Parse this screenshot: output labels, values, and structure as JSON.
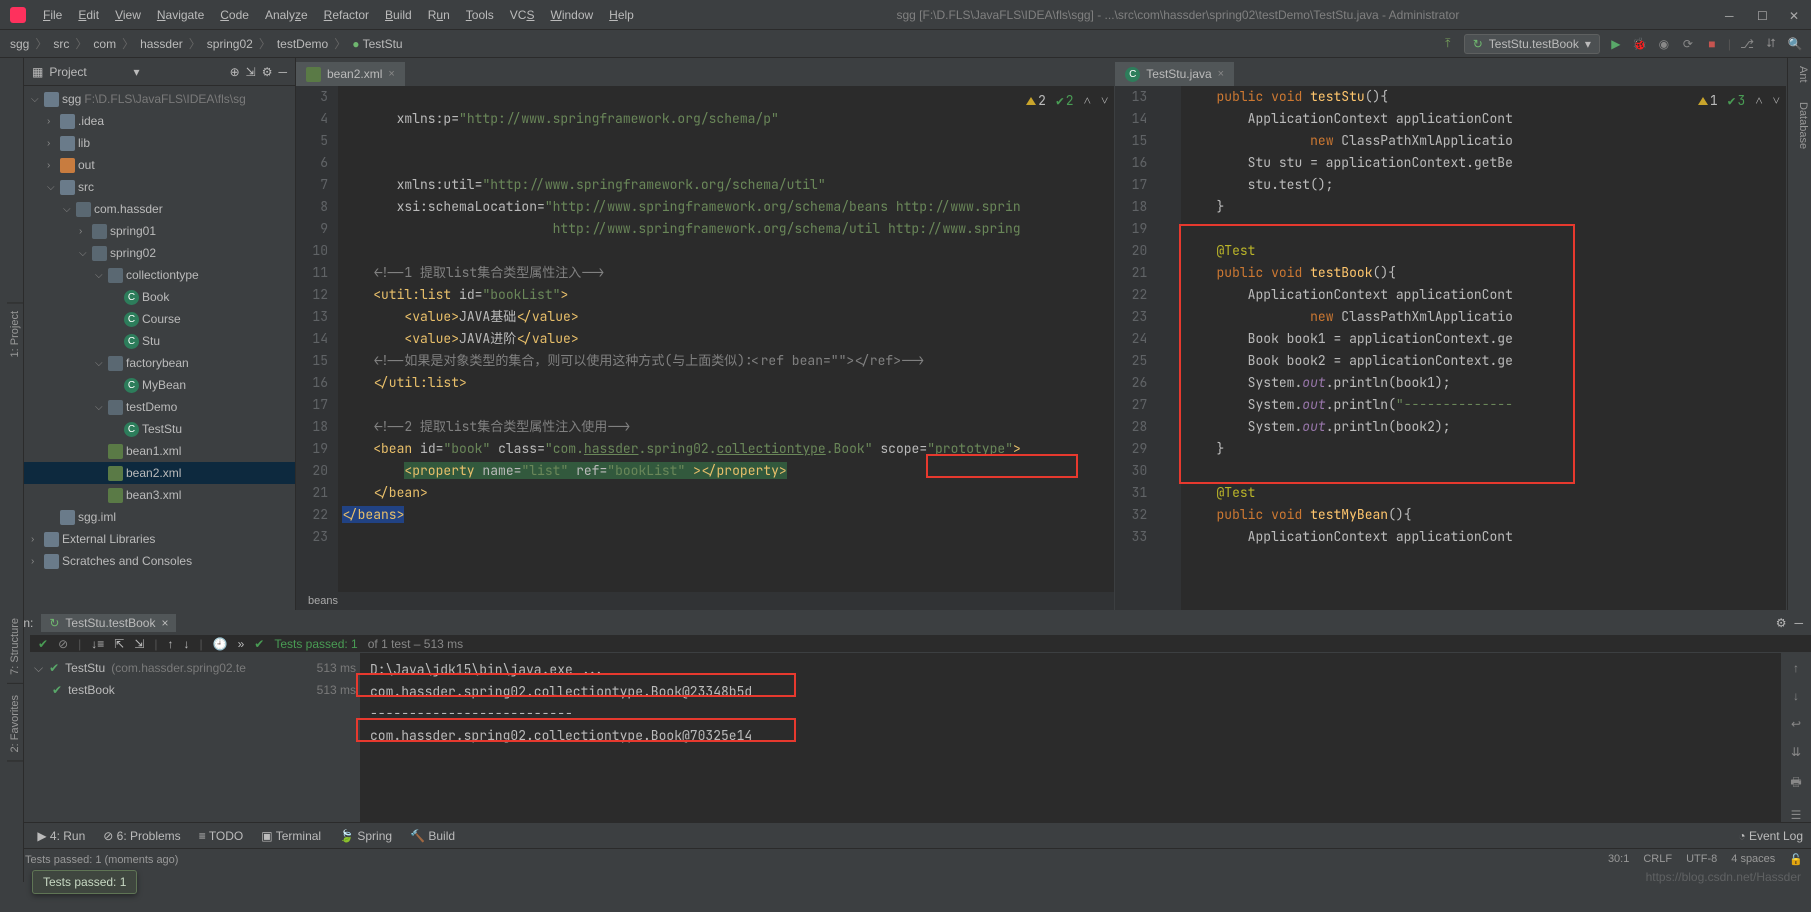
{
  "window": {
    "title": "sgg [F:\\D.FLS\\JavaFLS\\IDEA\\fls\\sgg] - ...\\src\\com\\hassder\\spring02\\testDemo\\TestStu.java - Administrator"
  },
  "menu": [
    "File",
    "Edit",
    "View",
    "Navigate",
    "Code",
    "Analyze",
    "Refactor",
    "Build",
    "Run",
    "Tools",
    "VCS",
    "Window",
    "Help"
  ],
  "breadcrumb": [
    "sgg",
    "src",
    "com",
    "hassder",
    "spring02",
    "testDemo",
    "TestStu"
  ],
  "runConfig": "TestStu.testBook",
  "projectPanel": {
    "title": "Project"
  },
  "tree": [
    {
      "d": 0,
      "a": "v",
      "i": "folder",
      "label": "sgg",
      "extra": " F:\\D.FLS\\JavaFLS\\IDEA\\fls\\sg"
    },
    {
      "d": 1,
      "a": ">",
      "i": "folder",
      "label": ".idea"
    },
    {
      "d": 1,
      "a": ">",
      "i": "folder",
      "label": "lib"
    },
    {
      "d": 1,
      "a": ">",
      "i": "folder orange",
      "label": "out"
    },
    {
      "d": 1,
      "a": "v",
      "i": "folder",
      "label": "src"
    },
    {
      "d": 2,
      "a": "v",
      "i": "pkg",
      "label": "com.hassder"
    },
    {
      "d": 3,
      "a": ">",
      "i": "pkg",
      "label": "spring01"
    },
    {
      "d": 3,
      "a": "v",
      "i": "pkg",
      "label": "spring02"
    },
    {
      "d": 4,
      "a": "v",
      "i": "pkg",
      "label": "collectiontype"
    },
    {
      "d": 5,
      "a": "",
      "i": "cls",
      "label": "Book"
    },
    {
      "d": 5,
      "a": "",
      "i": "cls",
      "label": "Course"
    },
    {
      "d": 5,
      "a": "",
      "i": "cls",
      "label": "Stu"
    },
    {
      "d": 4,
      "a": "v",
      "i": "pkg",
      "label": "factorybean"
    },
    {
      "d": 5,
      "a": "",
      "i": "cls",
      "label": "MyBean"
    },
    {
      "d": 4,
      "a": "v",
      "i": "pkg",
      "label": "testDemo"
    },
    {
      "d": 5,
      "a": "",
      "i": "cls",
      "label": "TestStu"
    },
    {
      "d": 4,
      "a": "",
      "i": "xml",
      "label": "bean1.xml"
    },
    {
      "d": 4,
      "a": "",
      "i": "xml",
      "label": "bean2.xml",
      "sel": true
    },
    {
      "d": 4,
      "a": "",
      "i": "xml",
      "label": "bean3.xml"
    },
    {
      "d": 1,
      "a": "",
      "i": "file",
      "label": "sgg.iml"
    },
    {
      "d": 0,
      "a": ">",
      "i": "folder",
      "label": "External Libraries"
    },
    {
      "d": 0,
      "a": ">",
      "i": "folder",
      "label": "Scratches and Consoles"
    }
  ],
  "leftEditor": {
    "tab": "bean2.xml",
    "inspections": {
      "warn": "2",
      "ok": "2"
    },
    "lines": [
      3,
      4,
      5,
      6,
      7,
      8,
      9,
      10,
      11,
      12,
      13,
      14,
      15,
      16,
      17,
      18,
      19,
      20,
      21,
      22,
      23
    ],
    "breadcrumb": "beans"
  },
  "rightEditor": {
    "tab": "TestStu.java",
    "inspections": {
      "warn": "1",
      "ok": "3"
    },
    "lines": [
      13,
      14,
      15,
      16,
      17,
      18,
      19,
      20,
      21,
      22,
      23,
      24,
      25,
      26,
      27,
      28,
      29,
      30,
      31,
      32,
      33
    ]
  },
  "run": {
    "label": "Run:",
    "tab": "TestStu.testBook",
    "status": "Tests passed: 1",
    "statusExtra": " of 1 test – 513 ms",
    "tree": [
      {
        "d": 0,
        "ok": true,
        "label": "TestStu",
        "extra": "(com.hassder.spring02.te",
        "time": "513 ms"
      },
      {
        "d": 1,
        "ok": true,
        "label": "testBook",
        "time": "513 ms"
      }
    ],
    "console": [
      "D:\\Java\\jdk15\\bin\\java.exe ...",
      "com.hassder.spring02.collectiontype.Book@23348b5d",
      "--------------------------",
      "com.hassder.spring02.collectiontype.Book@70325e14"
    ]
  },
  "popup": "Tests passed: 1",
  "bottomTabs": [
    "4: Run",
    "6: Problems",
    "TODO",
    "Terminal",
    "Spring",
    "Build"
  ],
  "eventLog": "Event Log",
  "status": {
    "msg": "Tests passed: 1 (moments ago)",
    "pos": "30:1",
    "eol": "CRLF",
    "enc": "UTF-8",
    "indent": "4 spaces"
  },
  "watermark": "https://blog.csdn.net/Hassder"
}
